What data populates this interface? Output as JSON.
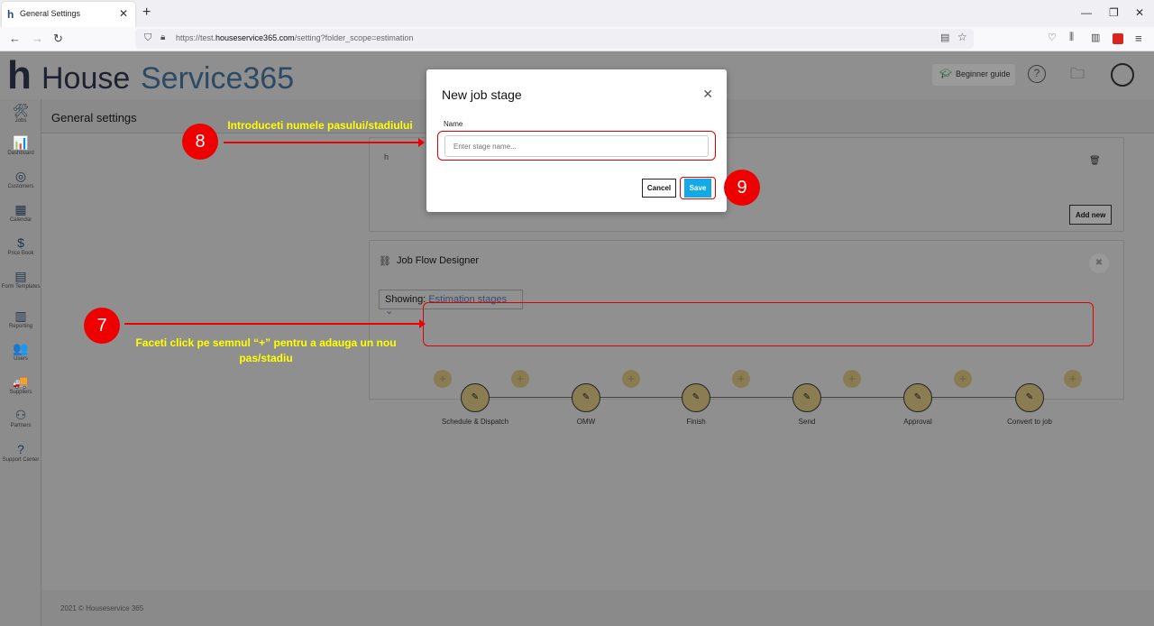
{
  "browser": {
    "tab_title": "General Settings",
    "tab_favicon": "h",
    "new_tab": "+",
    "url_prefix": "https://test.",
    "url_domain": "houseservice365.com",
    "url_path": "/setting?folder_scope=estimation"
  },
  "app": {
    "logo_h": "h",
    "logo_house": "House",
    "logo_service": "Service365",
    "beginner_guide": "Beginner guide",
    "page_title": "General settings",
    "sidebar": [
      {
        "label": "Jobs",
        "icon": "tools-icon",
        "glyph": "🛠"
      },
      {
        "label": "Dashboard",
        "icon": "chart-icon",
        "glyph": "📊"
      },
      {
        "label": "Customers",
        "icon": "customers-icon",
        "glyph": "◎"
      },
      {
        "label": "Calendar",
        "icon": "calendar-icon",
        "glyph": "▦"
      },
      {
        "label": "Price Book",
        "icon": "pricebook-icon",
        "glyph": "$"
      },
      {
        "label": "Form Templates",
        "icon": "form-icon",
        "glyph": "▤"
      },
      {
        "label": "Reporting",
        "icon": "reporting-icon",
        "glyph": "▥"
      },
      {
        "label": "Users",
        "icon": "users-icon",
        "glyph": "👥"
      },
      {
        "label": "Suppliers",
        "icon": "truck-icon",
        "glyph": "🚚"
      },
      {
        "label": "Partners",
        "icon": "partners-icon",
        "glyph": "⚇"
      },
      {
        "label": "Support Center",
        "icon": "support-icon",
        "glyph": "?"
      }
    ],
    "card1": {
      "row_text": "h",
      "add_new": "Add new"
    },
    "flow": {
      "title": "Job Flow Designer",
      "showing_label": "Showing:",
      "showing_value": "Estimation stages",
      "stages": [
        "Schedule & Dispatch",
        "OMW",
        "Finish",
        "Send",
        "Approval",
        "Convert to job"
      ]
    },
    "footer": "2021 © Houseservice 365"
  },
  "modal": {
    "title": "New job stage",
    "name_label": "Name",
    "name_placeholder": "Enter stage name...",
    "name_value": "",
    "cancel": "Cancel",
    "save": "Save"
  },
  "annotations": {
    "step7": "7",
    "step8": "8",
    "step9": "9",
    "text7": "Faceti click pe semnul “+” pentru a adauga un nou pas/stadiu",
    "text8": "Introduceti numele pasului/stadiului"
  },
  "colors": {
    "save": "#12a9e6",
    "callout": "#ee0000",
    "annotation_text": "#ffff00"
  }
}
